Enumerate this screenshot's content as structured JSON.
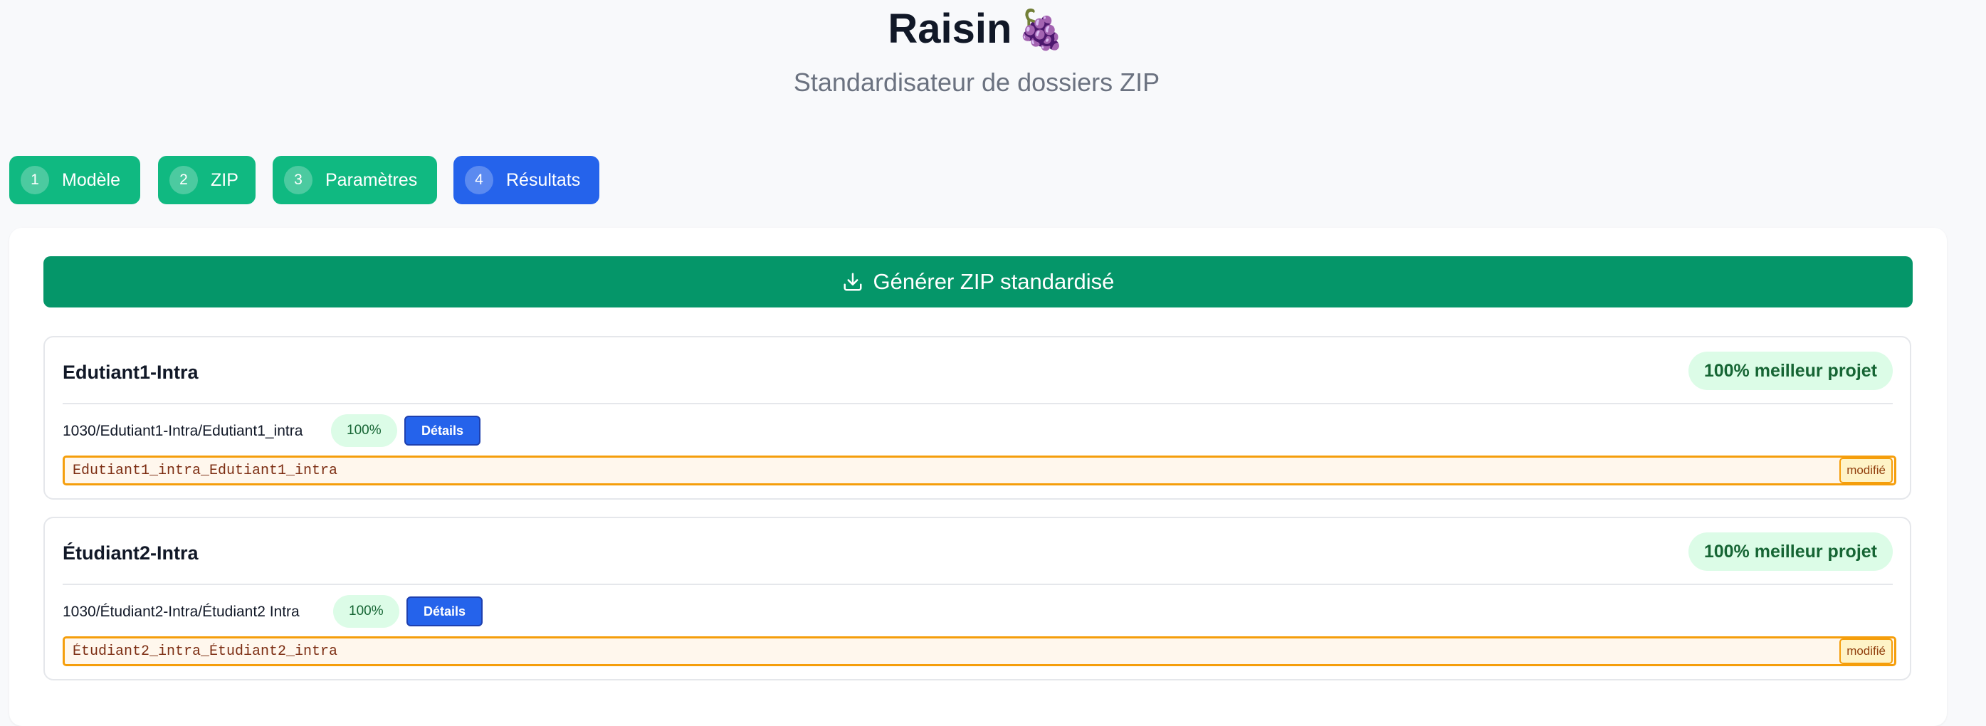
{
  "header": {
    "title": "Raisin",
    "title_emoji": "🍇",
    "subtitle": "Standardisateur de dossiers ZIP"
  },
  "steps": [
    {
      "num": "1",
      "label": "Modèle",
      "active": false
    },
    {
      "num": "2",
      "label": "ZIP",
      "active": false
    },
    {
      "num": "3",
      "label": "Paramètres",
      "active": false
    },
    {
      "num": "4",
      "label": "Résultats",
      "active": true
    }
  ],
  "results": {
    "generate_label": "Générer ZIP standardisé",
    "generate_icon": "download-icon",
    "projects": [
      {
        "name": "Edutiant1-Intra",
        "best_badge": "100% meilleur projet",
        "path": "1030/Edutiant1-Intra/Edutiant1_intra",
        "percent": "100%",
        "details_label": "Détails",
        "standardized_name": "Edutiant1_intra_Edutiant1_intra",
        "modified_label": "modifié"
      },
      {
        "name": "Étudiant2-Intra",
        "best_badge": "100% meilleur projet",
        "path": "1030/Étudiant2-Intra/Étudiant2 Intra",
        "percent": "100%",
        "details_label": "Détails",
        "standardized_name": "Étudiant2_intra_Étudiant2_intra",
        "modified_label": "modifié"
      }
    ]
  },
  "colors": {
    "step_done": "#10b981",
    "step_active": "#2563eb",
    "generate_button": "#059669",
    "modified_border": "#f59e0b"
  }
}
